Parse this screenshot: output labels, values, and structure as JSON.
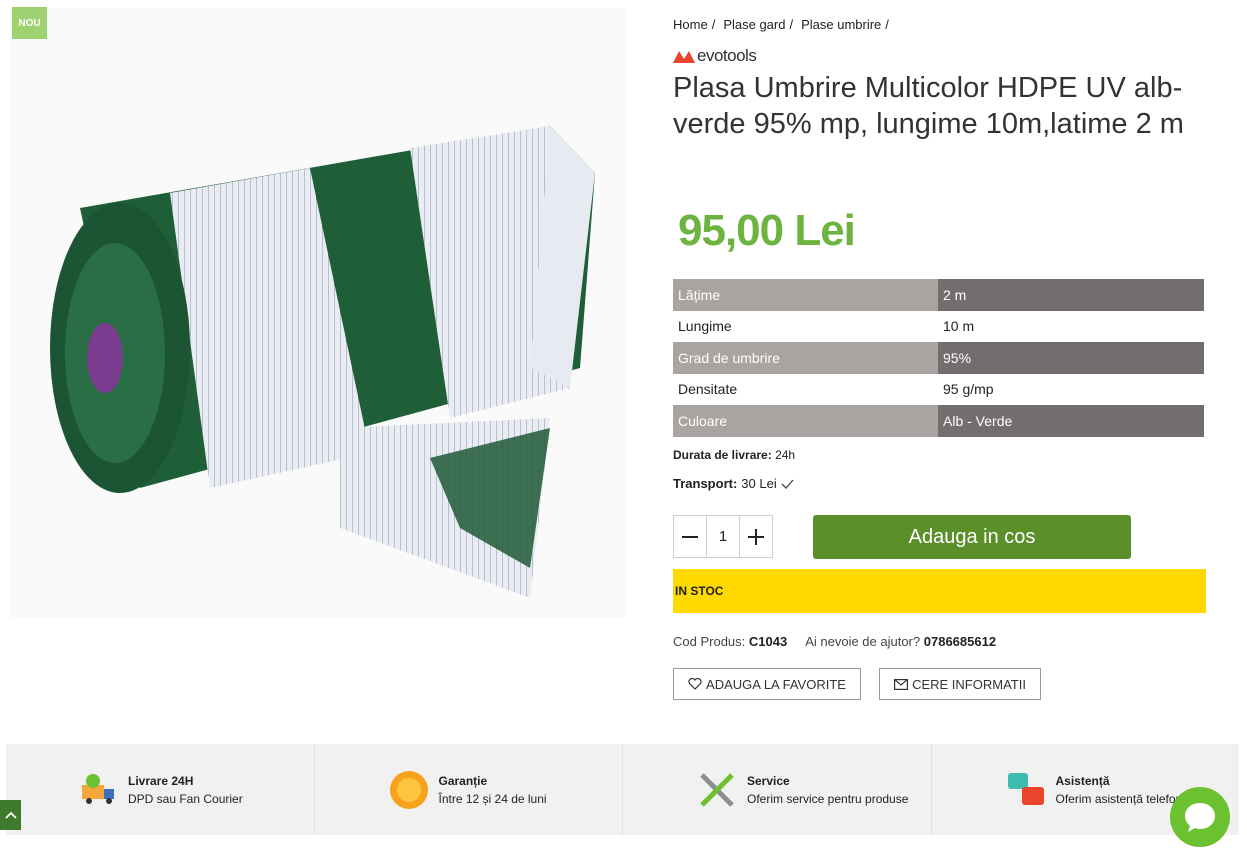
{
  "badge": "NOU",
  "breadcrumb": [
    "Home",
    "Plase gard",
    "Plase umbrire"
  ],
  "brand": "evotools",
  "title": "Plasa Umbrire Multicolor HDPE UV alb-verde 95% mp, lungime 10m,latime 2 m",
  "price": "95,00 Lei",
  "specs": [
    {
      "key": "Lățime",
      "value": "2 m"
    },
    {
      "key": "Lungime",
      "value": "10 m"
    },
    {
      "key": "Grad de umbrire",
      "value": "95%"
    },
    {
      "key": "Densitate",
      "value": "95 g/mp"
    },
    {
      "key": "Culoare",
      "value": "Alb - Verde"
    }
  ],
  "delivery": {
    "label": "Durata de livrare:",
    "value": "24h"
  },
  "transport": {
    "label": "Transport:",
    "value": "30 Lei"
  },
  "quantity": "1",
  "add_to_cart": "Adauga in cos",
  "stock": "IN STOC",
  "code": {
    "label": "Cod Produs:",
    "value": "C1043"
  },
  "help": {
    "label": "Ai nevoie de ajutor?",
    "phone": "0786685612"
  },
  "favorite_button": "ADAUGA LA FAVORITE",
  "info_button": "CERE INFORMATII",
  "features": [
    {
      "title": "Livrare 24H",
      "subtitle": "DPD sau Fan Courier",
      "icon": "delivery-truck-icon"
    },
    {
      "title": "Garanție",
      "subtitle": "Între 12 și 24 de luni",
      "icon": "warranty-badge-icon"
    },
    {
      "title": "Service",
      "subtitle": "Oferim service pentru produse",
      "icon": "tools-icon"
    },
    {
      "title": "Asistență",
      "subtitle": "Oferim asistență telefonică",
      "icon": "chat-bubbles-icon"
    }
  ],
  "colors": {
    "price": "#6db33f",
    "cart": "#5a8f29",
    "stock": "#ffd900",
    "spec_dark": "#736e6d",
    "spec_light": "#a9a4a2"
  }
}
